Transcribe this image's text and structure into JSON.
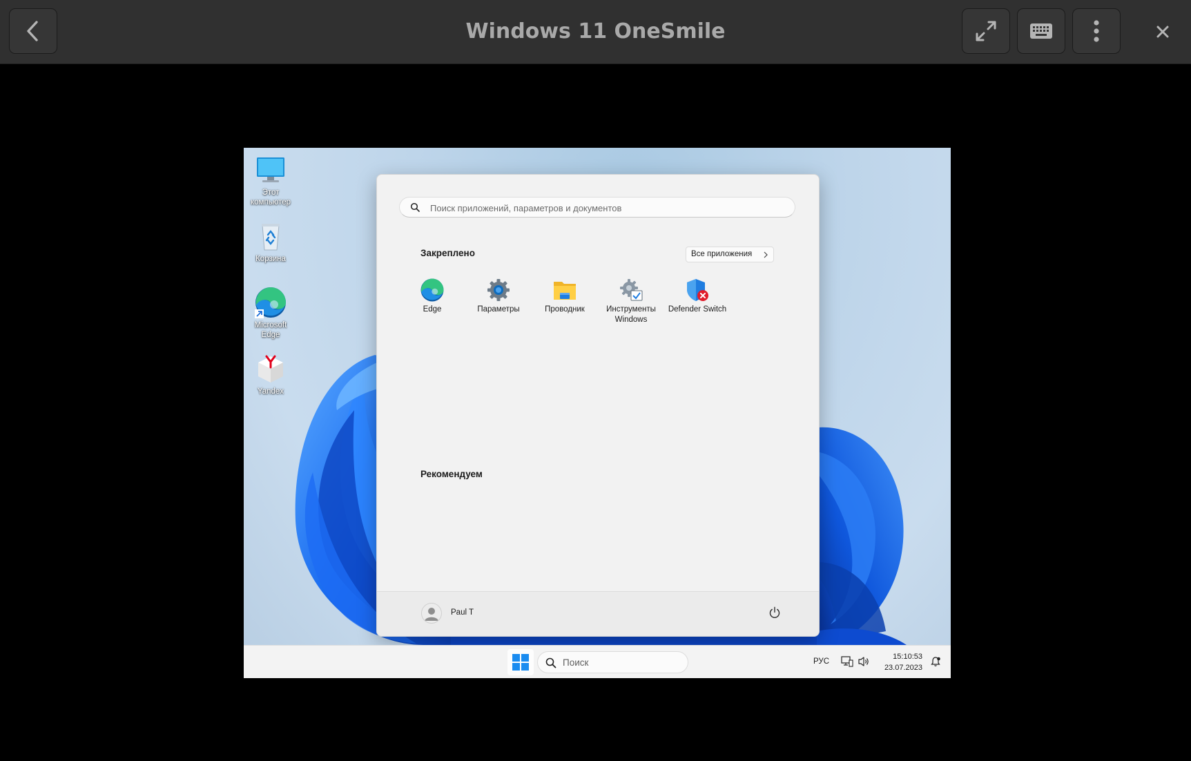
{
  "viewer": {
    "title": "Windows 11 OneSmile",
    "icons": [
      "back-icon",
      "fullscreen-icon",
      "keyboard-icon",
      "more-vertical-icon",
      "close-icon"
    ]
  },
  "desktop": {
    "icons": [
      {
        "label_line1": "Этот",
        "label_line2": "компьютер",
        "icon": "monitor-icon"
      },
      {
        "label_line1": "Корзина",
        "label_line2": "",
        "icon": "recycle-bin-icon"
      },
      {
        "label_line1": "Microsoft",
        "label_line2": "Edge",
        "icon": "edge-icon"
      },
      {
        "label_line1": "Yandex",
        "label_line2": "",
        "icon": "yandex-icon"
      }
    ]
  },
  "start_menu": {
    "search_placeholder": "Поиск приложений, параметров и документов",
    "pinned_title": "Закреплено",
    "all_apps_label": "Все приложения",
    "pinned": [
      {
        "line1": "Edge",
        "line2": "",
        "icon": "edge-icon"
      },
      {
        "line1": "Параметры",
        "line2": "",
        "icon": "settings-gear-icon"
      },
      {
        "line1": "Проводник",
        "line2": "",
        "icon": "folder-icon"
      },
      {
        "line1": "Инструменты",
        "line2": "Windows",
        "icon": "windows-tools-icon"
      },
      {
        "line1": "Defender Switch",
        "line2": "",
        "icon": "defender-shield-icon"
      }
    ],
    "recommended_title": "Рекомендуем",
    "user_name": "Paul T"
  },
  "taskbar": {
    "search_label": "Поиск",
    "language": "РУС",
    "time": "15:10:53",
    "date": "23.07.2023"
  },
  "colors": {
    "viewer_bg": "#303030",
    "accent": "#0067c0",
    "bloom_blue": "#0a5ce6"
  }
}
